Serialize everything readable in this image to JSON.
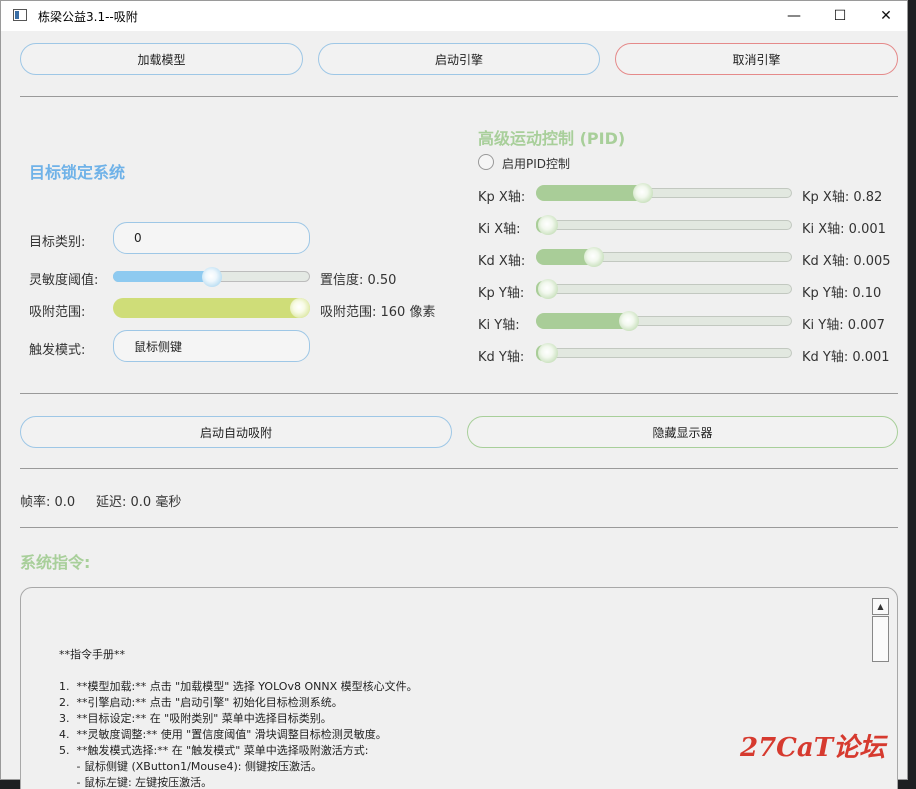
{
  "window": {
    "title": "栋梁公益3.1--吸附",
    "minimize_glyph": "—",
    "maximize_glyph": "☐",
    "close_glyph": "✕"
  },
  "toolbar": {
    "load_model": "加载模型",
    "start_engine": "启动引擎",
    "cancel_engine": "取消引擎"
  },
  "target_lock": {
    "title": "目标锁定系统",
    "target_class_label": "目标类别:",
    "target_class_value": "0",
    "sensitivity_label": "灵敏度阈值:",
    "confidence_text": "置信度: 0.50",
    "confidence_value": 0.5,
    "range_label": "吸附范围:",
    "range_text": "吸附范围: 160 像素",
    "range_fraction": 1.0,
    "trigger_label": "触发模式:",
    "trigger_value": "鼠标侧键"
  },
  "pid": {
    "title": "高级运动控制 (PID)",
    "enable_label": "启用PID控制",
    "enabled": false,
    "sliders": [
      {
        "label": "Kp X轴:",
        "value_text": "Kp X轴: 0.82",
        "fraction": 0.41
      },
      {
        "label": "Ki X轴:",
        "value_text": "Ki X轴: 0.001",
        "fraction": 0.0
      },
      {
        "label": "Kd X轴:",
        "value_text": "Kd X轴: 0.005",
        "fraction": 0.2
      },
      {
        "label": "Kp Y轴:",
        "value_text": "Kp Y轴: 0.10",
        "fraction": 0.0
      },
      {
        "label": "Ki Y轴:",
        "value_text": "Ki Y轴: 0.007",
        "fraction": 0.35
      },
      {
        "label": "Kd Y轴:",
        "value_text": "Kd Y轴: 0.001",
        "fraction": 0.0
      }
    ]
  },
  "actions": {
    "auto_aim": "启动自动吸附",
    "hide_display": "隐藏显示器"
  },
  "status": {
    "fps": "帧率: 0.0",
    "latency": "延迟: 0.0 毫秒"
  },
  "manual": {
    "title": "系统指令:",
    "lines": [
      "**指令手册**",
      "",
      "1.  **模型加载:** 点击 \"加载模型\" 选择 YOLOv8 ONNX 模型核心文件。",
      "2.  **引擎启动:** 点击 \"启动引擎\" 初始化目标检测系统。",
      "3.  **目标设定:** 在 \"吸附类别\" 菜单中选择目标类别。",
      "4.  **灵敏度调整:** 使用 \"置信度阈值\" 滑块调整目标检测灵敏度。",
      "5.  **触发模式选择:** 在 \"触发模式\" 菜单中选择吸附激活方式:",
      "     - 鼠标侧键 (XButton1/Mouse4): 侧键按压激活。",
      "     - 鼠标左键: 左键按压激活。"
    ]
  },
  "watermark": "27CaT论坛",
  "colors": {
    "blue_title": "#6fb2e8",
    "green_title": "#a8cf9a",
    "blue_track": "#8ecaf0",
    "yellow_green_track": "#cfdd78",
    "pid_track": "#a9cd98",
    "watermark": "#d63a2f"
  }
}
